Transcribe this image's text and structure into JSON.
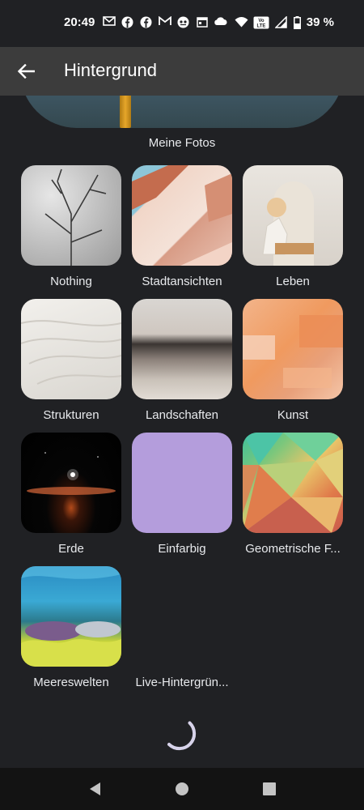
{
  "status_bar": {
    "time": "20:49",
    "battery": "39 %",
    "icons_left": [
      "mail-icon",
      "facebook-icon",
      "facebook-icon",
      "gmail-icon",
      "app-icon",
      "calendar-icon",
      "cloud-icon"
    ],
    "icons_right": [
      "wifi-icon",
      "volte-icon",
      "signal-icon",
      "battery-icon"
    ],
    "volte_text": "Vo LTE"
  },
  "app_bar": {
    "title": "Hintergrund"
  },
  "my_photos": {
    "label": "Meine Fotos"
  },
  "categories": [
    {
      "label": "Nothing"
    },
    {
      "label": "Stadtansichten"
    },
    {
      "label": "Leben"
    },
    {
      "label": "Strukturen"
    },
    {
      "label": "Landschaften"
    },
    {
      "label": "Kunst"
    },
    {
      "label": "Erde"
    },
    {
      "label": "Einfarbig"
    },
    {
      "label": "Geometrische F..."
    },
    {
      "label": "Meereswelten"
    },
    {
      "label": "Live-Hintergrün..."
    }
  ],
  "colors": {
    "background": "#202124",
    "app_bar": "#3c3c3c",
    "einfarbig": "#b49ddc",
    "spinner": "#d7d3ea"
  }
}
